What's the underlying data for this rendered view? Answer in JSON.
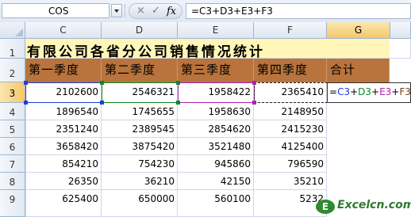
{
  "formula_bar": {
    "name_box": "COS",
    "cancel_icon": "×",
    "enter_icon": "✓",
    "fx_label": "fx",
    "formula": "=C3+D3+E3+F3"
  },
  "columns": [
    "C",
    "D",
    "E",
    "F",
    "G"
  ],
  "rows": [
    "1",
    "2",
    "3",
    "4",
    "5",
    "6",
    "7",
    "8",
    "9"
  ],
  "sheet": {
    "title": "有限公司各省分公司销售情况统计",
    "headers": [
      "第一季度",
      "第二季度",
      "第三季度",
      "第四季度",
      "合计"
    ],
    "data": [
      [
        "2102600",
        "2546321",
        "1958422",
        "2365410"
      ],
      [
        "1896540",
        "1745655",
        "1958630",
        "2148950"
      ],
      [
        "2351240",
        "2389545",
        "2854620",
        "2415230"
      ],
      [
        "3658420",
        "3875420",
        "3521480",
        "4125400"
      ],
      [
        "854210",
        "754230",
        "945860",
        "796590"
      ],
      [
        "26350",
        "36210",
        "42150",
        "35210"
      ],
      [
        "625400",
        "650000",
        "560100",
        "5232"
      ]
    ],
    "edit_formula_parts": [
      "=",
      "C3",
      "+",
      "D3",
      "+",
      "E3",
      "+",
      "F3"
    ]
  },
  "watermark": {
    "badge": "E",
    "text": "Excelcn.com"
  },
  "colors": {
    "title_bg": "#fff6b8",
    "header_bg": "#b8743c",
    "ref_c": "#1f3fd8",
    "ref_d": "#0a8a2a",
    "ref_e": "#b020b0",
    "ref_f": "#7a3d10"
  }
}
